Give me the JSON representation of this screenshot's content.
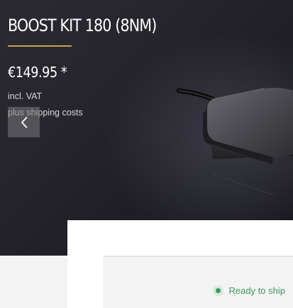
{
  "product": {
    "title": "BOOST KIT 180 (8NM)",
    "price": "€149.95 *",
    "vat_note": "incl. VAT",
    "shipping_note": "plus shipping costs"
  },
  "gallery": {
    "prev_icon": "chevron-left-icon"
  },
  "availability": {
    "status": "Ready to ship",
    "status_color": "#3d9a5c"
  },
  "colors": {
    "accent": "#c9a44a",
    "hero_background": "#1c1c22"
  }
}
